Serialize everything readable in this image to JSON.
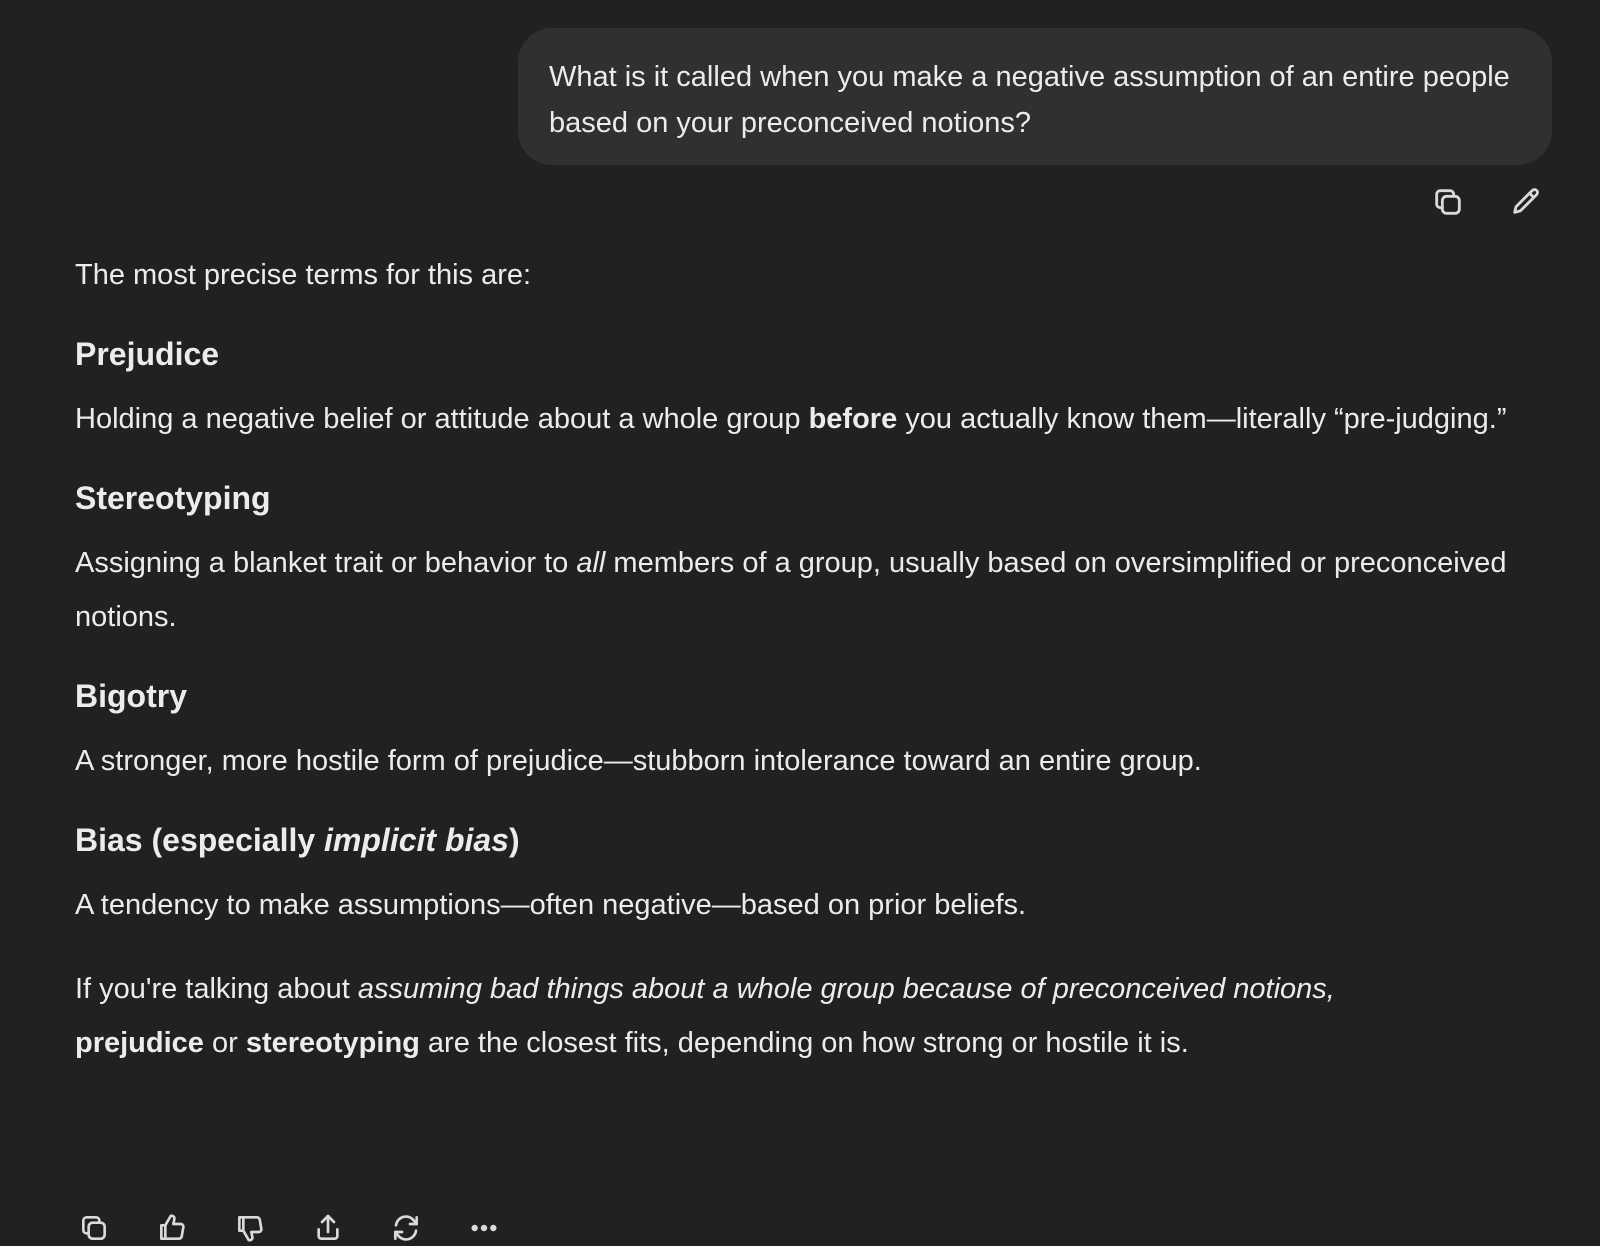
{
  "user_message": {
    "text": "What is it called when you make a negative assumption of an entire people based on your preconceived notions?"
  },
  "user_actions": {
    "copy_icon": "copy-icon",
    "edit_icon": "pencil-icon"
  },
  "assistant": {
    "intro": "The most precise terms for this are:",
    "terms": [
      {
        "heading": "Prejudice",
        "def_1": "Holding a negative belief or attitude about a whole group ",
        "def_bold": "before",
        "def_2": " you actually know them—literally “pre-judging.”"
      },
      {
        "heading": "Stereotyping",
        "def_1": "Assigning a blanket trait or behavior to ",
        "def_italic": "all",
        "def_2": " members of a group, usually based on oversimplified or preconceived notions."
      },
      {
        "heading": "Bigotry",
        "def": "A stronger, more hostile form of prejudice—stubborn intolerance toward an entire group."
      },
      {
        "heading_1": "Bias (especially ",
        "heading_italic": "implicit bias",
        "heading_2": ")",
        "def": "A tendency to make assumptions—often negative—based on prior beliefs."
      }
    ],
    "conclusion": {
      "part_1": "If you're talking about ",
      "italic": "assuming bad things about a whole group because of preconceived notions,",
      "bold_1": "prejudice",
      "mid": " or ",
      "bold_2": "stereotyping",
      "end": " are the closest fits, depending on how strong or hostile it is."
    }
  },
  "assistant_actions": {
    "icons": [
      "copy-icon",
      "thumbs-up-icon",
      "thumbs-down-icon",
      "share-icon",
      "regenerate-icon",
      "more-icon"
    ]
  },
  "colors": {
    "background": "#212121",
    "user_bubble": "#303030",
    "text": "#ececec",
    "icon": "#d9d9d9"
  }
}
